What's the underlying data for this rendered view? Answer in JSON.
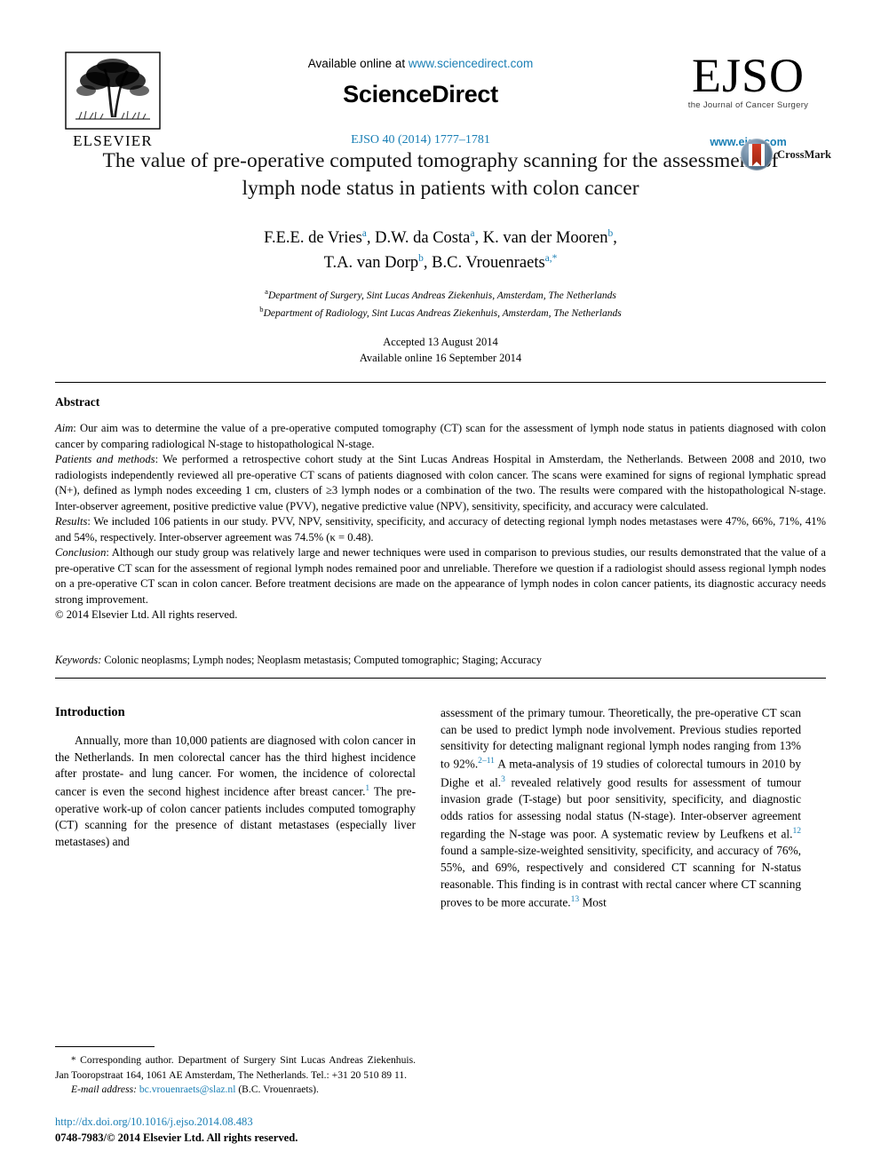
{
  "header": {
    "publisher": "ELSEVIER",
    "available_prefix": "Available online at ",
    "available_url": "www.sciencedirect.com",
    "sciencedirect_logo": "ScienceDirect",
    "citation": "EJSO 40 (2014) 1777–1781",
    "journal_logo": "EJSO",
    "journal_tagline": "the Journal of Cancer Surgery",
    "journal_url": "www.ejso.com"
  },
  "article": {
    "title": "The value of pre-operative computed tomography scanning for the assessment of lymph node status in patients with colon cancer",
    "crossmark_label": "CrossMark",
    "authors_line_1": "F.E.E. de Vries a, D.W. da Costa a, K. van der Mooren b,",
    "authors_line_2": "T.A. van Dorp b, B.C. Vrouenraets a,*",
    "authors": [
      {
        "name": "F.E.E. de Vries",
        "mark": "a"
      },
      {
        "name": "D.W. da Costa",
        "mark": "a"
      },
      {
        "name": "K. van der Mooren",
        "mark": "b"
      },
      {
        "name": "T.A. van Dorp",
        "mark": "b"
      },
      {
        "name": "B.C. Vrouenraets",
        "mark": "a,*"
      }
    ],
    "affiliations": [
      {
        "mark": "a",
        "text": "Department of Surgery, Sint Lucas Andreas Ziekenhuis, Amsterdam, The Netherlands"
      },
      {
        "mark": "b",
        "text": "Department of Radiology, Sint Lucas Andreas Ziekenhuis, Amsterdam, The Netherlands"
      }
    ],
    "accepted": "Accepted 13 August 2014",
    "available_online": "Available online 16 September 2014"
  },
  "abstract": {
    "heading": "Abstract",
    "sections": [
      {
        "label": "Aim",
        "text": ": Our aim was to determine the value of a pre-operative computed tomography (CT) scan for the assessment of lymph node status in patients diagnosed with colon cancer by comparing radiological N-stage to histopathological N-stage."
      },
      {
        "label": "Patients and methods",
        "text": ": We performed a retrospective cohort study at the Sint Lucas Andreas Hospital in Amsterdam, the Netherlands. Between 2008 and 2010, two radiologists independently reviewed all pre-operative CT scans of patients diagnosed with colon cancer. The scans were examined for signs of regional lymphatic spread (N+), defined as lymph nodes exceeding 1 cm, clusters of ≥3 lymph nodes or a combination of the two. The results were compared with the histopathological N-stage. Inter-observer agreement, positive predictive value (PVV), negative predictive value (NPV), sensitivity, specificity, and accuracy were calculated."
      },
      {
        "label": "Results",
        "text": ": We included 106 patients in our study. PVV, NPV, sensitivity, specificity, and accuracy of detecting regional lymph nodes metastases were 47%, 66%, 71%, 41% and 54%, respectively. Inter-observer agreement was 74.5% (κ = 0.48)."
      },
      {
        "label": "Conclusion",
        "text": ": Although our study group was relatively large and newer techniques were used in comparison to previous studies, our results demonstrated that the value of a pre-operative CT scan for the assessment of regional lymph nodes remained poor and unreliable. Therefore we question if a radiologist should assess regional lymph nodes on a pre-operative CT scan in colon cancer. Before treatment decisions are made on the appearance of lymph nodes in colon cancer patients, its diagnostic accuracy needs strong improvement."
      }
    ],
    "copyright": "© 2014 Elsevier Ltd. All rights reserved.",
    "keywords_label": "Keywords:",
    "keywords": " Colonic neoplasms; Lymph nodes; Neoplasm metastasis; Computed tomographic; Staging; Accuracy"
  },
  "introduction": {
    "heading": "Introduction",
    "left_paragraph_part1": "Annually, more than 10,000 patients are diagnosed with colon cancer in the Netherlands. In men colorectal cancer has the third highest incidence after prostate- and lung cancer. For women, the incidence of colorectal cancer is even the second highest incidence after breast cancer.",
    "ref_1": "1",
    "left_paragraph_part2": " The pre-operative work-up of colon cancer patients includes computed tomography (CT) scanning for the presence of distant metastases (especially liver metastases) and",
    "right_part1": "assessment of the primary tumour. Theoretically, the pre-operative CT scan can be used to predict lymph node involvement. Previous studies reported sensitivity for detecting malignant regional lymph nodes ranging from 13% to 92%.",
    "ref_2_11": "2–11",
    "right_part2": " A meta-analysis of 19 studies of colorectal tumours in 2010 by Dighe et al.",
    "ref_3": "3",
    "right_part3": " revealed relatively good results for assessment of tumour invasion grade (T-stage) but poor sensitivity, specificity, and diagnostic odds ratios for assessing nodal status (N-stage). Inter-observer agreement regarding the N-stage was poor. A systematic review by Leufkens et al.",
    "ref_12": "12",
    "right_part4": " found a sample-size-weighted sensitivity, specificity, and accuracy of 76%, 55%, and 69%, respectively and considered CT scanning for N-status reasonable. This finding is in contrast with rectal cancer where CT scanning proves to be more accurate.",
    "ref_13": "13",
    "right_part5": " Most"
  },
  "footnote": {
    "star": "*",
    "corresponding": " Corresponding author. Department of Surgery Sint Lucas Andreas Ziekenhuis. Jan Tooropstraat 164, 1061 AE Amsterdam, The Netherlands. Tel.: +31 20 510 89 11.",
    "email_label": "E-mail address:",
    "email": "bc.vrouenraets@slaz.nl",
    "email_owner": " (B.C. Vrouenraets)."
  },
  "bottom": {
    "doi": "http://dx.doi.org/10.1016/j.ejso.2014.08.483",
    "issn": "0748-7983/© 2014 Elsevier Ltd. All rights reserved."
  },
  "colors": {
    "link_blue": "#1a7fb5",
    "crossmark_red": "#c0301a",
    "crossmark_blue": "#5f7c96"
  }
}
